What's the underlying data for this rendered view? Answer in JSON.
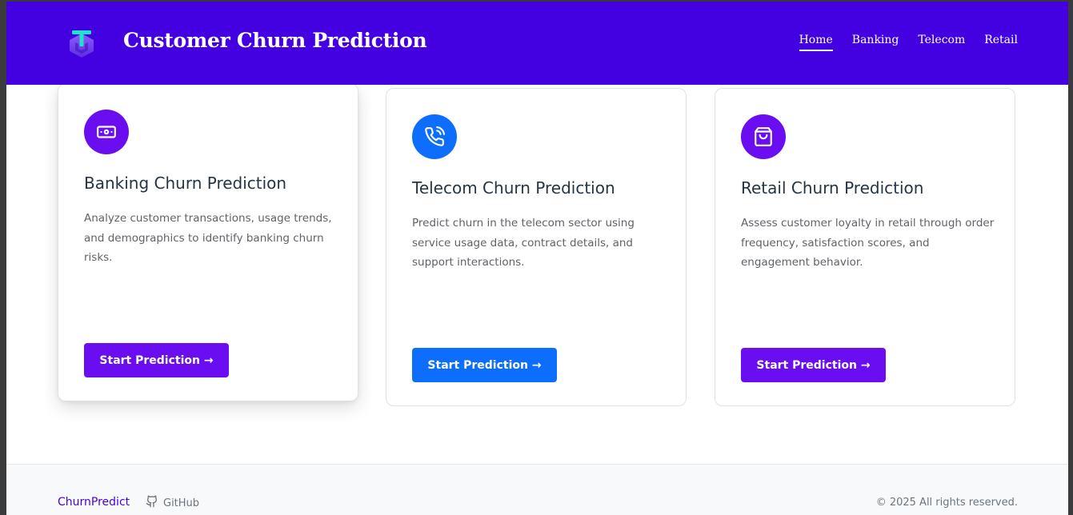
{
  "header": {
    "title": "Customer Churn Prediction",
    "nav": [
      {
        "label": "Home",
        "active": true
      },
      {
        "label": "Banking"
      },
      {
        "label": "Telecom"
      },
      {
        "label": "Retail"
      }
    ]
  },
  "cards": [
    {
      "icon": "money-icon",
      "title": "Banking Churn Prediction",
      "description": "Analyze customer transactions, usage trends, and demographics to identify banking churn risks.",
      "button": "Start Prediction →",
      "color": "#6a0df0"
    },
    {
      "icon": "phone-icon",
      "title": "Telecom Churn Prediction",
      "description": "Predict churn in the telecom sector using service usage data, contract details, and support interactions.",
      "button": "Start Prediction →",
      "color": "#0d6efd"
    },
    {
      "icon": "shopping-bag-icon",
      "title": "Retail Churn Prediction",
      "description": "Assess customer loyalty in retail through order frequency, satisfaction scores, and engagement behavior.",
      "button": "Start Prediction →",
      "color": "#6a0df0"
    }
  ],
  "footer": {
    "brand": "ChurnPredict",
    "github": "GitHub",
    "copyright": "© 2025 All rights reserved."
  },
  "colors": {
    "header_bg": "#4300e0",
    "purple": "#6a0df0",
    "blue": "#0d6efd"
  }
}
